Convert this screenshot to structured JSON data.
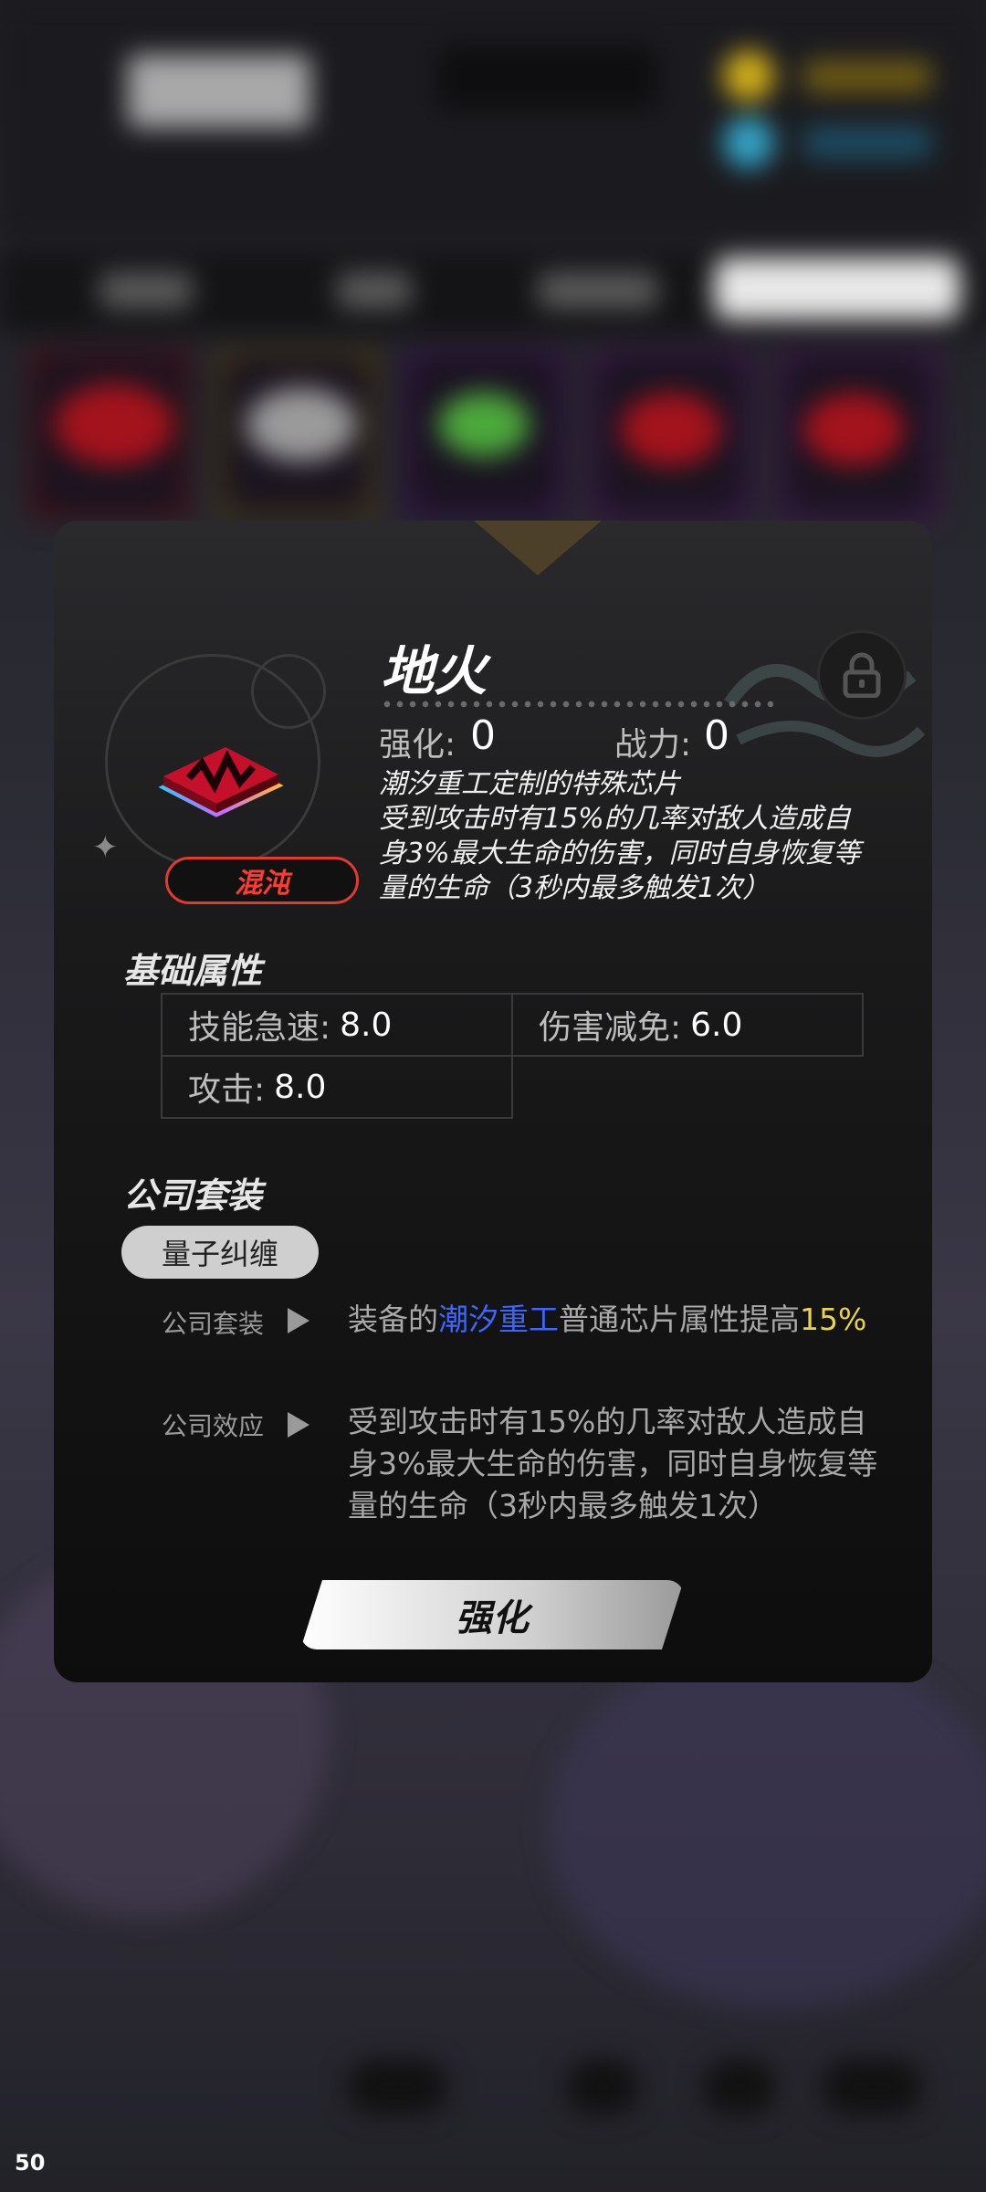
{
  "item": {
    "name": "地火",
    "rarity": "混沌",
    "enhance_label": "强化:",
    "enhance_value": "0",
    "power_label": "战力:",
    "power_value": "0",
    "description": "潮汐重工定制的特殊芯片\n受到攻击时有15%的几率对敌人造成自身3%最大生命的伤害，同时自身恢复等量的生命（3秒内最多触发1次）",
    "locked": true
  },
  "base_attributes": {
    "title": "基础属性",
    "rows": [
      {
        "key": "技能急速:",
        "value": "8.0"
      },
      {
        "key": "伤害减免:",
        "value": "6.0"
      },
      {
        "key": "攻击:",
        "value": "8.0"
      }
    ]
  },
  "company_set": {
    "title": "公司套装",
    "set_name": "量子纠缠",
    "set_bonus_label": "公司套装",
    "set_bonus_prefix": "装备的",
    "set_bonus_company": "潮汐重工",
    "set_bonus_middle": "普通芯片属性提高",
    "set_bonus_value": "15%",
    "effect_label": "公司效应",
    "effect_text": "受到攻击时有15%的几率对敌人造成自身3%最大生命的伤害，同时自身恢复等量的生命（3秒内最多触发1次）"
  },
  "actions": {
    "enhance_button": "强化"
  },
  "overlay": {
    "fps": "50"
  },
  "icons": {
    "lock": "lock-icon",
    "chip": "chip-icon",
    "arrow": "play-arrow-icon",
    "sparkle": "sparkle-icon"
  },
  "colors": {
    "rarity": "#ff3c32",
    "company_highlight": "#3b67ff",
    "value_highlight": "#e8d44c"
  }
}
